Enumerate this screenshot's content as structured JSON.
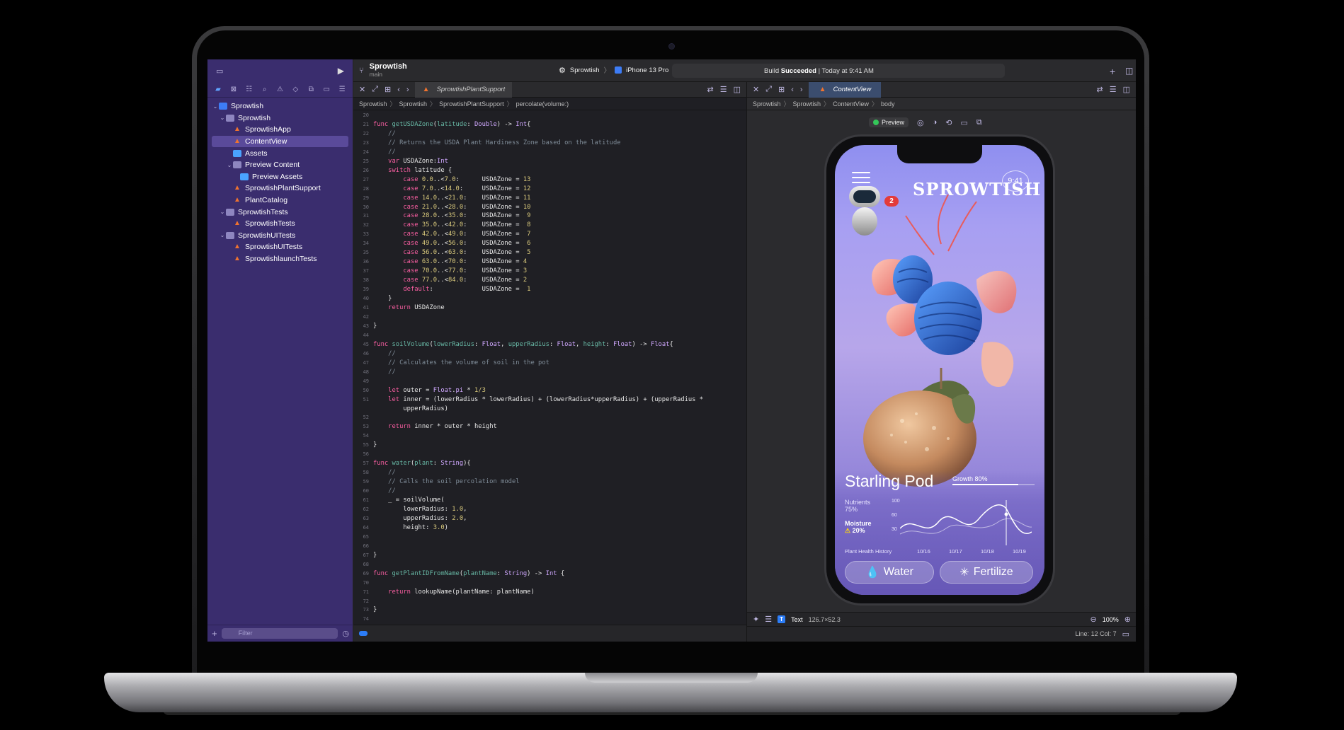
{
  "toolbar": {
    "project": "Sprowtish",
    "branch": "main",
    "scheme": "Sprowtish",
    "device": "iPhone 13 Pro",
    "status_prefix": "Build",
    "status_bold": "Succeeded",
    "status_suffix": "| Today at 9:41 AM"
  },
  "sidebar": {
    "filter_placeholder": "Filter",
    "items": [
      {
        "label": "Sprowtish",
        "icon": "project-icon",
        "indent": 0,
        "chevron": "open"
      },
      {
        "label": "Sprowtish",
        "icon": "folder-icon",
        "indent": 1,
        "chevron": "open"
      },
      {
        "label": "SprowtishApp",
        "icon": "swift-file-icon",
        "indent": 2
      },
      {
        "label": "ContentView",
        "icon": "swift-file-icon",
        "indent": 2,
        "selected": true
      },
      {
        "label": "Assets",
        "icon": "asset-catalog-icon",
        "indent": 2
      },
      {
        "label": "Preview Content",
        "icon": "folder-icon",
        "indent": 2,
        "chevron": "open"
      },
      {
        "label": "Preview Assets",
        "icon": "asset-catalog-icon",
        "indent": 3
      },
      {
        "label": "SprowtishPlantSupport",
        "icon": "swift-file-icon",
        "indent": 2
      },
      {
        "label": "PlantCatalog",
        "icon": "swift-file-icon",
        "indent": 2
      },
      {
        "label": "SprowtishTests",
        "icon": "folder-icon",
        "indent": 1,
        "chevron": "open"
      },
      {
        "label": "SprowtishTests",
        "icon": "swift-file-icon",
        "indent": 2
      },
      {
        "label": "SprowtishUITests",
        "icon": "folder-icon",
        "indent": 1,
        "chevron": "open"
      },
      {
        "label": "SprowtishUITests",
        "icon": "swift-file-icon",
        "indent": 2
      },
      {
        "label": "SprowtishlaunchTests",
        "icon": "swift-file-icon",
        "indent": 2
      }
    ]
  },
  "editor": {
    "tab": "SprowtishPlantSupport",
    "breadcrumb": [
      "Sprowtish",
      "Sprowtish",
      "SprowtishPlantSupport",
      "percolate(volume:)"
    ],
    "lines": [
      {
        "n": "20",
        "t": []
      },
      {
        "n": "21",
        "t": [
          [
            "kw",
            "func "
          ],
          [
            "fn",
            "getUSDAZone"
          ],
          [
            "pl",
            "("
          ],
          [
            "fn",
            "latitude"
          ],
          [
            "pl",
            ": "
          ],
          [
            "ty",
            "Double"
          ],
          [
            "pl",
            ") -> "
          ],
          [
            "ty",
            "Int"
          ],
          [
            "pl",
            "{"
          ]
        ]
      },
      {
        "n": "22",
        "t": [
          [
            "cm",
            "    //"
          ]
        ]
      },
      {
        "n": "23",
        "t": [
          [
            "cm",
            "    // Returns the USDA Plant Hardiness Zone based on the latitude"
          ]
        ]
      },
      {
        "n": "24",
        "t": [
          [
            "cm",
            "    //"
          ]
        ]
      },
      {
        "n": "25",
        "t": [
          [
            "kw",
            "    var "
          ],
          [
            "pl",
            "USDAZone:"
          ],
          [
            "ty",
            "Int"
          ]
        ]
      },
      {
        "n": "26",
        "t": [
          [
            "kw",
            "    switch "
          ],
          [
            "pl",
            "latitude {"
          ]
        ]
      },
      {
        "n": "27",
        "t": [
          [
            "kw",
            "        case "
          ],
          [
            "nm",
            "0.0"
          ],
          [
            "pl",
            "..<"
          ],
          [
            "nm",
            "7.0"
          ],
          [
            "pl",
            ":      USDAZone = "
          ],
          [
            "nm",
            "13"
          ]
        ]
      },
      {
        "n": "28",
        "t": [
          [
            "kw",
            "        case "
          ],
          [
            "nm",
            "7.0"
          ],
          [
            "pl",
            "..<"
          ],
          [
            "nm",
            "14.0"
          ],
          [
            "pl",
            ":     USDAZone = "
          ],
          [
            "nm",
            "12"
          ]
        ]
      },
      {
        "n": "29",
        "t": [
          [
            "kw",
            "        case "
          ],
          [
            "nm",
            "14.0"
          ],
          [
            "pl",
            "..<"
          ],
          [
            "nm",
            "21.0"
          ],
          [
            "pl",
            ":    USDAZone = "
          ],
          [
            "nm",
            "11"
          ]
        ]
      },
      {
        "n": "30",
        "t": [
          [
            "kw",
            "        case "
          ],
          [
            "nm",
            "21.0"
          ],
          [
            "pl",
            "..<"
          ],
          [
            "nm",
            "28.0"
          ],
          [
            "pl",
            ":    USDAZone = "
          ],
          [
            "nm",
            "10"
          ]
        ]
      },
      {
        "n": "31",
        "t": [
          [
            "kw",
            "        case "
          ],
          [
            "nm",
            "28.0"
          ],
          [
            "pl",
            "..<"
          ],
          [
            "nm",
            "35.0"
          ],
          [
            "pl",
            ":    USDAZone =  "
          ],
          [
            "nm",
            "9"
          ]
        ]
      },
      {
        "n": "32",
        "t": [
          [
            "kw",
            "        case "
          ],
          [
            "nm",
            "35.0"
          ],
          [
            "pl",
            "..<"
          ],
          [
            "nm",
            "42.0"
          ],
          [
            "pl",
            ":    USDAZone =  "
          ],
          [
            "nm",
            "8"
          ]
        ]
      },
      {
        "n": "33",
        "t": [
          [
            "kw",
            "        case "
          ],
          [
            "nm",
            "42.0"
          ],
          [
            "pl",
            "..<"
          ],
          [
            "nm",
            "49.0"
          ],
          [
            "pl",
            ":    USDAZone =  "
          ],
          [
            "nm",
            "7"
          ]
        ]
      },
      {
        "n": "34",
        "t": [
          [
            "kw",
            "        case "
          ],
          [
            "nm",
            "49.0"
          ],
          [
            "pl",
            "..<"
          ],
          [
            "nm",
            "56.0"
          ],
          [
            "pl",
            ":    USDAZone =  "
          ],
          [
            "nm",
            "6"
          ]
        ]
      },
      {
        "n": "35",
        "t": [
          [
            "kw",
            "        case "
          ],
          [
            "nm",
            "56.0"
          ],
          [
            "pl",
            "..<"
          ],
          [
            "nm",
            "63.0"
          ],
          [
            "pl",
            ":    USDAZone =  "
          ],
          [
            "nm",
            "5"
          ]
        ]
      },
      {
        "n": "36",
        "t": [
          [
            "kw",
            "        case "
          ],
          [
            "nm",
            "63.0"
          ],
          [
            "pl",
            "..<"
          ],
          [
            "nm",
            "70.0"
          ],
          [
            "pl",
            ":    USDAZone = "
          ],
          [
            "nm",
            "4"
          ]
        ]
      },
      {
        "n": "37",
        "t": [
          [
            "kw",
            "        case "
          ],
          [
            "nm",
            "70.0"
          ],
          [
            "pl",
            "..<"
          ],
          [
            "nm",
            "77.0"
          ],
          [
            "pl",
            ":    USDAZone = "
          ],
          [
            "nm",
            "3"
          ]
        ]
      },
      {
        "n": "38",
        "t": [
          [
            "kw",
            "        case "
          ],
          [
            "nm",
            "77.0"
          ],
          [
            "pl",
            "..<"
          ],
          [
            "nm",
            "84.0"
          ],
          [
            "pl",
            ":    USDAZone = "
          ],
          [
            "nm",
            "2"
          ]
        ]
      },
      {
        "n": "39",
        "t": [
          [
            "kw",
            "        default"
          ],
          [
            "pl",
            ":             USDAZone =  "
          ],
          [
            "nm",
            "1"
          ]
        ]
      },
      {
        "n": "40",
        "t": [
          [
            "pl",
            "    }"
          ]
        ]
      },
      {
        "n": "41",
        "t": [
          [
            "kw",
            "    return "
          ],
          [
            "pl",
            "USDAZone"
          ]
        ]
      },
      {
        "n": "42",
        "t": []
      },
      {
        "n": "43",
        "t": [
          [
            "pl",
            "}"
          ]
        ]
      },
      {
        "n": "44",
        "t": []
      },
      {
        "n": "45",
        "t": [
          [
            "kw",
            "func "
          ],
          [
            "fn",
            "soilVolume"
          ],
          [
            "pl",
            "("
          ],
          [
            "fn",
            "lowerRadius"
          ],
          [
            "pl",
            ": "
          ],
          [
            "ty",
            "Float"
          ],
          [
            "pl",
            ", "
          ],
          [
            "fn",
            "upperRadius"
          ],
          [
            "pl",
            ": "
          ],
          [
            "ty",
            "Float"
          ],
          [
            "pl",
            ", "
          ],
          [
            "fn",
            "height"
          ],
          [
            "pl",
            ": "
          ],
          [
            "ty",
            "Float"
          ],
          [
            "pl",
            ") -> "
          ],
          [
            "ty",
            "Float"
          ],
          [
            "pl",
            "{"
          ]
        ]
      },
      {
        "n": "46",
        "t": [
          [
            "cm",
            "    //"
          ]
        ]
      },
      {
        "n": "47",
        "t": [
          [
            "cm",
            "    // Calculates the volume of soil in the pot"
          ]
        ]
      },
      {
        "n": "48",
        "t": [
          [
            "cm",
            "    //"
          ]
        ]
      },
      {
        "n": "49",
        "t": []
      },
      {
        "n": "50",
        "t": [
          [
            "kw",
            "    let "
          ],
          [
            "pl",
            "outer = "
          ],
          [
            "ty",
            "Float"
          ],
          [
            "pl",
            "."
          ],
          [
            "ty",
            "pi"
          ],
          [
            "pl",
            " * "
          ],
          [
            "nm",
            "1/3"
          ]
        ]
      },
      {
        "n": "51",
        "t": [
          [
            "kw",
            "    let "
          ],
          [
            "pl",
            "inner = (lowerRadius * lowerRadius) + (lowerRadius*upperRadius) + (upperRadius *"
          ]
        ]
      },
      {
        "n": "",
        "t": [
          [
            "pl",
            "        upperRadius)"
          ]
        ]
      },
      {
        "n": "52",
        "t": []
      },
      {
        "n": "53",
        "t": [
          [
            "kw",
            "    return "
          ],
          [
            "pl",
            "inner * outer * height"
          ]
        ]
      },
      {
        "n": "54",
        "t": []
      },
      {
        "n": "55",
        "t": [
          [
            "pl",
            "}"
          ]
        ]
      },
      {
        "n": "56",
        "t": []
      },
      {
        "n": "57",
        "t": [
          [
            "kw",
            "func "
          ],
          [
            "fn",
            "water"
          ],
          [
            "pl",
            "("
          ],
          [
            "fn",
            "plant"
          ],
          [
            "pl",
            ": "
          ],
          [
            "ty",
            "String"
          ],
          [
            "pl",
            "){"
          ]
        ]
      },
      {
        "n": "58",
        "t": [
          [
            "cm",
            "    //"
          ]
        ]
      },
      {
        "n": "59",
        "t": [
          [
            "cm",
            "    // Calls the soil percolation model"
          ]
        ]
      },
      {
        "n": "60",
        "t": [
          [
            "cm",
            "    //"
          ]
        ]
      },
      {
        "n": "61",
        "t": [
          [
            "pl",
            "    _ = soilVolume("
          ]
        ]
      },
      {
        "n": "62",
        "t": [
          [
            "pl",
            "        lowerRadius: "
          ],
          [
            "nm",
            "1.0"
          ],
          [
            "pl",
            ","
          ]
        ]
      },
      {
        "n": "63",
        "t": [
          [
            "pl",
            "        upperRadius: "
          ],
          [
            "nm",
            "2.0"
          ],
          [
            "pl",
            ","
          ]
        ]
      },
      {
        "n": "64",
        "t": [
          [
            "pl",
            "        height: "
          ],
          [
            "nm",
            "3.0"
          ],
          [
            "pl",
            ")"
          ]
        ]
      },
      {
        "n": "65",
        "t": []
      },
      {
        "n": "66",
        "t": []
      },
      {
        "n": "67",
        "t": [
          [
            "pl",
            "}"
          ]
        ]
      },
      {
        "n": "68",
        "t": []
      },
      {
        "n": "69",
        "t": [
          [
            "kw",
            "func "
          ],
          [
            "fn",
            "getPlantIDFromName"
          ],
          [
            "pl",
            "("
          ],
          [
            "fn",
            "plantName"
          ],
          [
            "pl",
            ": "
          ],
          [
            "ty",
            "String"
          ],
          [
            "pl",
            ") -> "
          ],
          [
            "ty",
            "Int"
          ],
          [
            "pl",
            " {"
          ]
        ]
      },
      {
        "n": "70",
        "t": []
      },
      {
        "n": "71",
        "t": [
          [
            "kw",
            "    return "
          ],
          [
            "pl",
            "lookupName(plantName: plantName)"
          ]
        ]
      },
      {
        "n": "72",
        "t": []
      },
      {
        "n": "73",
        "t": [
          [
            "pl",
            "}"
          ]
        ]
      },
      {
        "n": "74",
        "t": []
      }
    ]
  },
  "canvas": {
    "tab": "ContentView",
    "breadcrumb": [
      "Sprowtish",
      "Sprowtish",
      "ContentView",
      "body"
    ],
    "preview_label": "Preview",
    "selection_type": "Text",
    "selection_size": "126.7×52.3",
    "zoom": "100%",
    "line_col": "Line: 12  Col: 7"
  },
  "app": {
    "logo": "SPROWTISH",
    "time": "9:41",
    "notification_count": "2",
    "plant_name": "Starling Pod",
    "growth_label": "Growth 80%",
    "growth": 0.8,
    "nutrients_label": "Nutrients",
    "nutrients_value": "75%",
    "moisture_label": "Moisture",
    "moisture_value": "20%",
    "axis": [
      "100",
      "60",
      "30"
    ],
    "history_label": "Plant Health History",
    "dates": [
      "10/16",
      "10/17",
      "10/18",
      "10/19"
    ],
    "water_label": "Water",
    "fertilize_label": "Fertilize"
  },
  "colors": {
    "sidebar_bg": "#3a2d6e",
    "accent": "#2c7df7",
    "keyword": "#fc5fa3",
    "function": "#67b7a4",
    "number": "#d9c97c",
    "comment": "#7f8c98"
  }
}
